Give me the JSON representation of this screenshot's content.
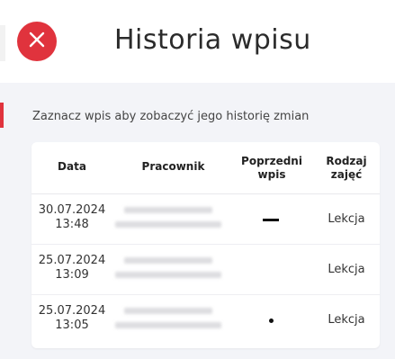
{
  "header": {
    "title": "Historia wpisu",
    "close_icon": "close-icon",
    "accent_color": "#e0333d"
  },
  "instruction": "Zaznacz wpis aby zobaczyć jego historię zmian",
  "table": {
    "columns": [
      {
        "line1": "Data",
        "line2": ""
      },
      {
        "line1": "Pracownik",
        "line2": ""
      },
      {
        "line1": "Poprzedni",
        "line2": "wpis"
      },
      {
        "line1": "Rodzaj",
        "line2": "zajęć"
      }
    ],
    "rows": [
      {
        "date": "30.07.2024",
        "time": "13:48",
        "previous": "dash-icon",
        "type": "Lekcja"
      },
      {
        "date": "25.07.2024",
        "time": "13:09",
        "previous": "",
        "type": "Lekcja"
      },
      {
        "date": "25.07.2024",
        "time": "13:05",
        "previous": "dot-icon",
        "type": "Lekcja"
      }
    ]
  }
}
